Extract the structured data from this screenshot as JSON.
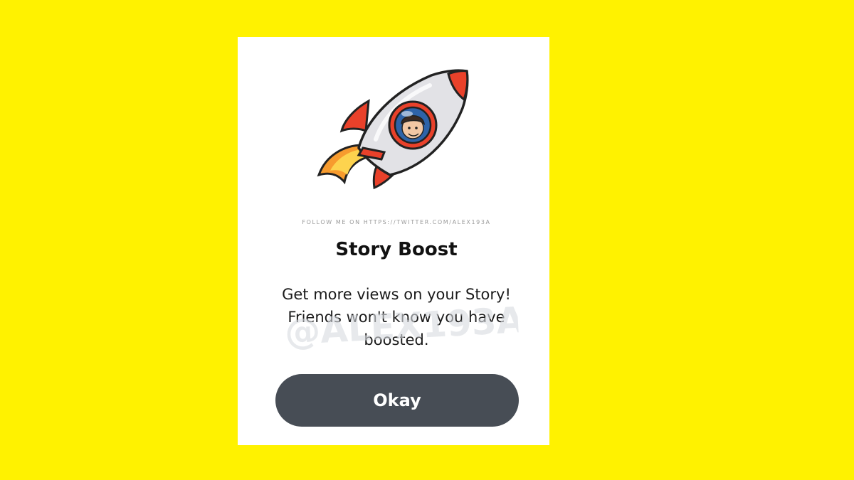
{
  "dialog": {
    "credit_text": "FOLLOW ME ON HTTPS://TWITTER.COM/ALEX193A",
    "title": "Story Boost",
    "description": "Get more views on your Story! Friends won't know you have boosted.",
    "watermark_text": "@ALEX193A",
    "okay_label": "Okay"
  },
  "colors": {
    "background": "#FFF200",
    "card": "#FFFFFF",
    "button": "#474D55",
    "button_text": "#FFFFFF",
    "rocket_red": "#E9412A",
    "rocket_body": "#E2E2E6"
  },
  "icons": {
    "illustration": "rocket-with-bitmoji-icon"
  }
}
